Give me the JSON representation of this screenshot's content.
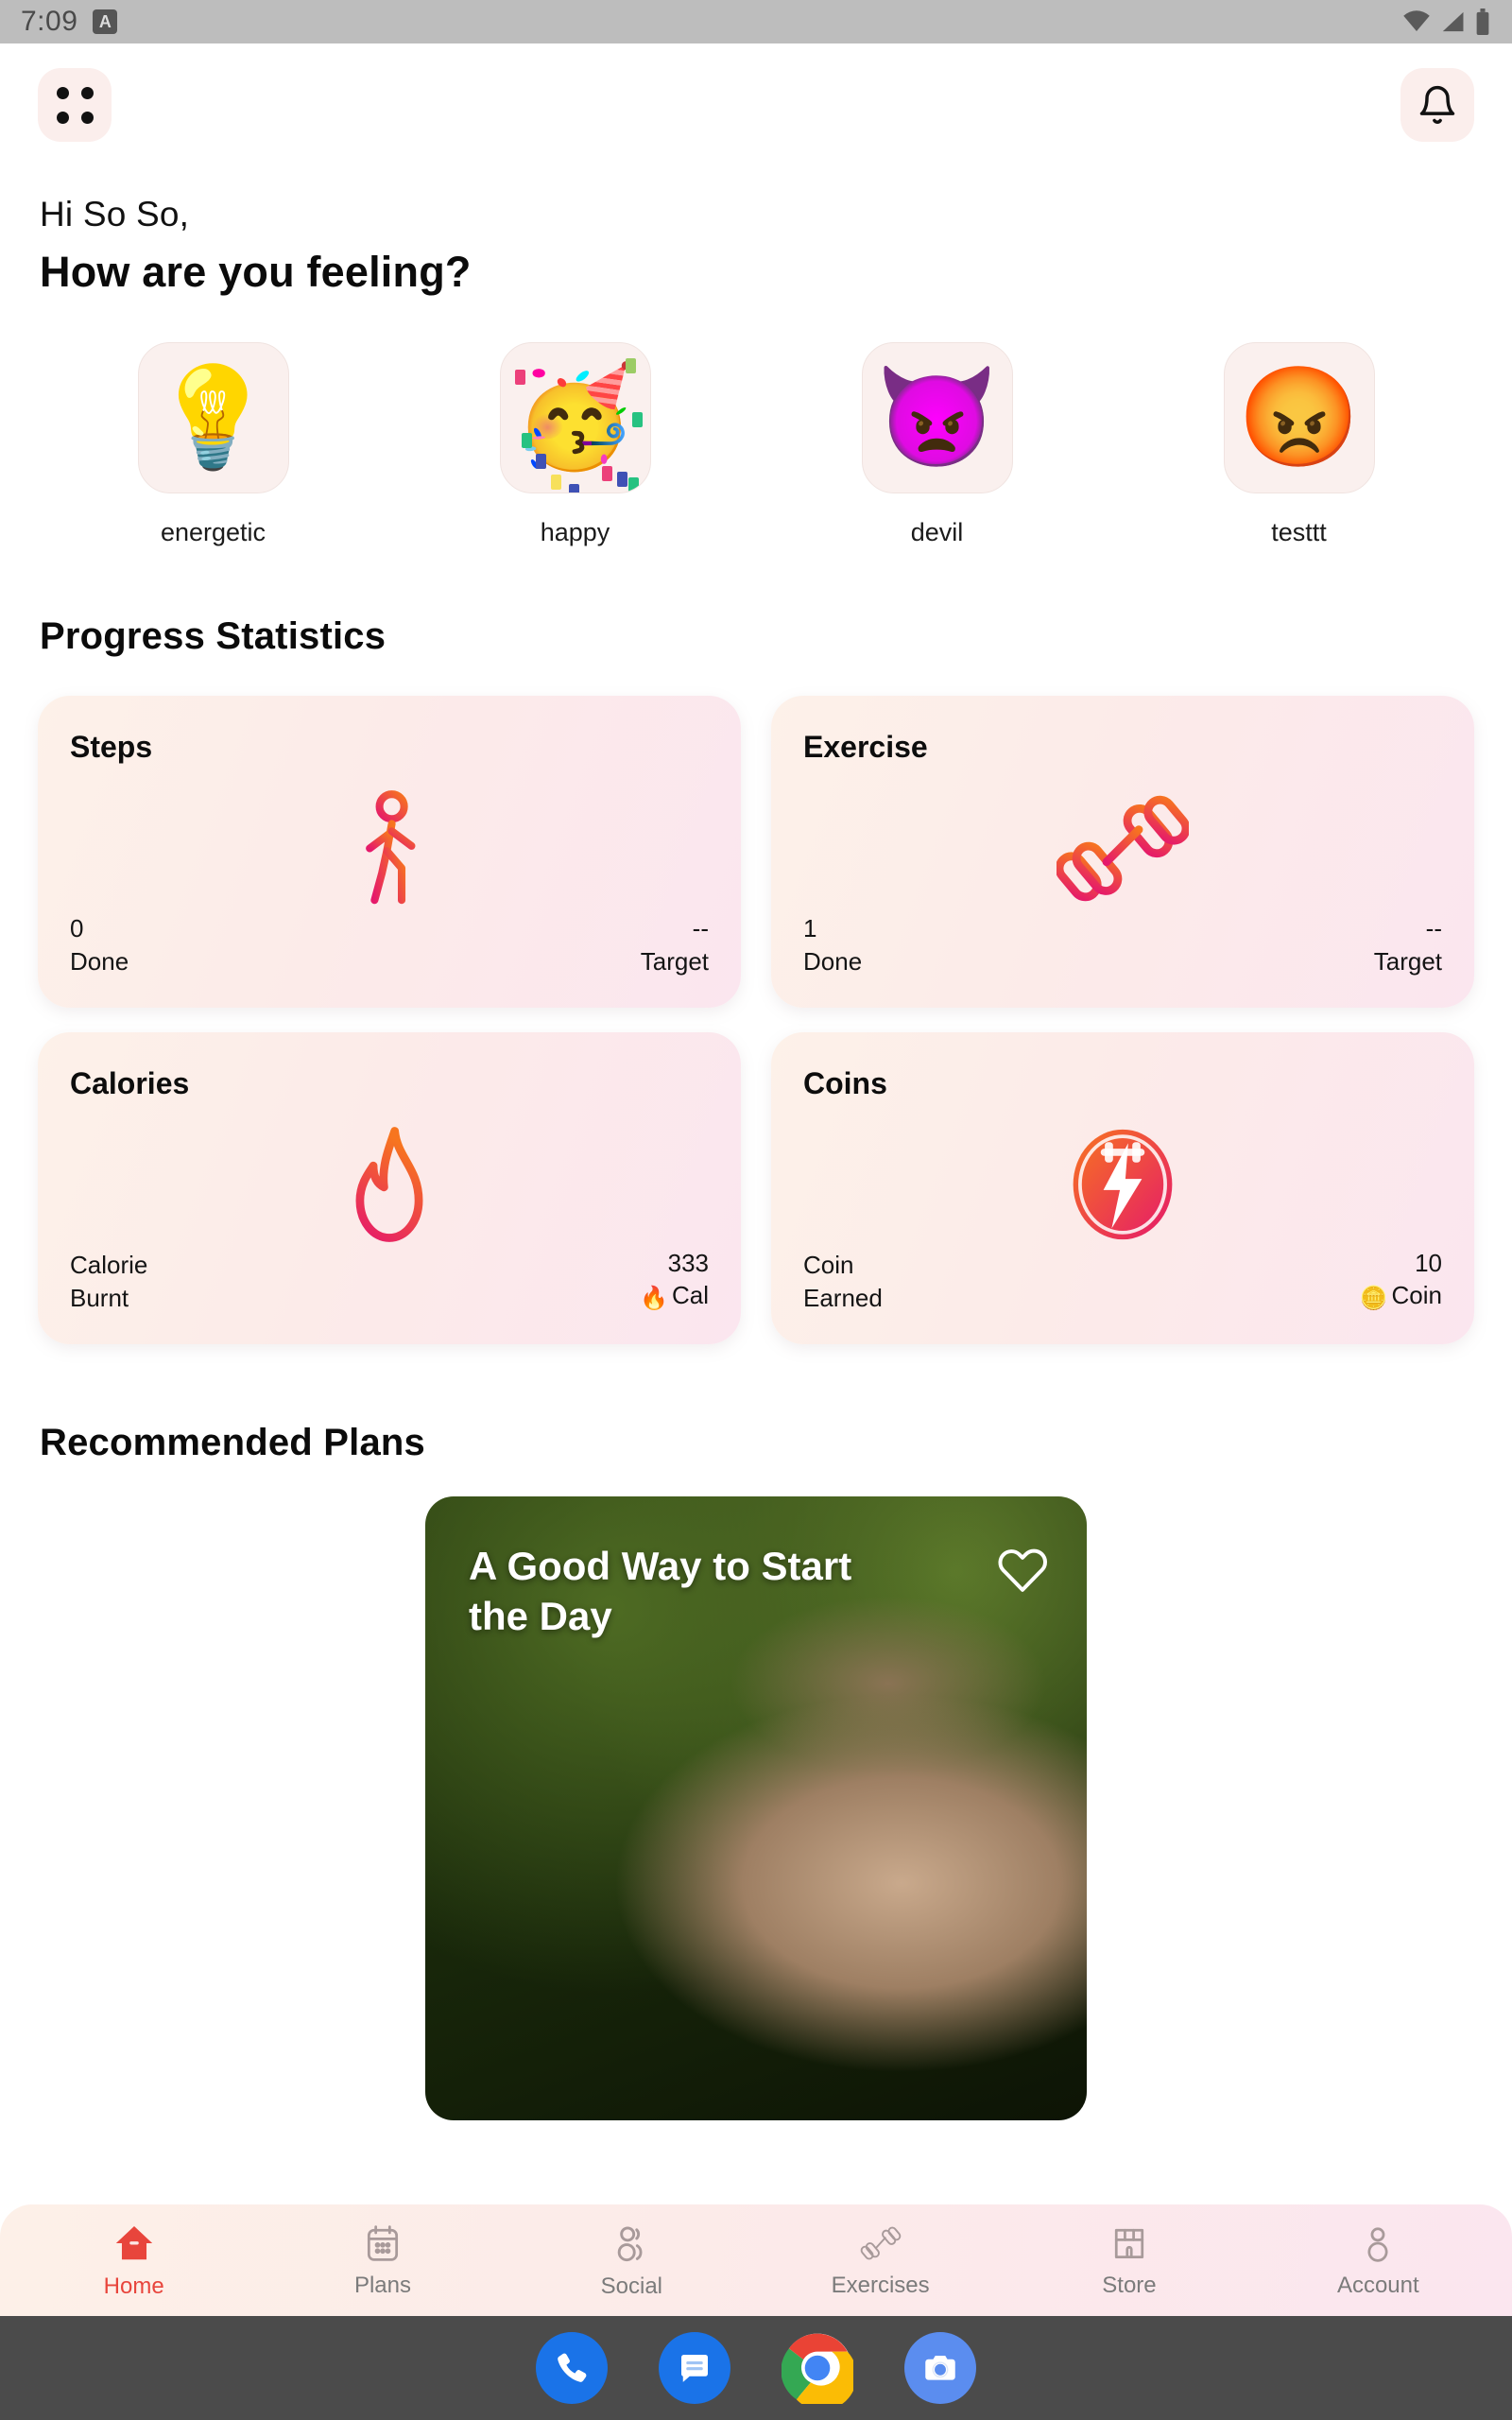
{
  "status_bar": {
    "time": "7:09",
    "alarm_badge": "A",
    "icons": [
      "wifi-icon",
      "cellular-signal-icon",
      "battery-icon"
    ]
  },
  "app_bar": {
    "menu_icon": "grid-menu-icon",
    "notification_icon": "bell-icon"
  },
  "greeting": {
    "hi": "Hi So So,",
    "question": "How are you feeling?"
  },
  "moods": {
    "items": [
      {
        "label": "energetic",
        "emoji": "💡",
        "icon": "light-bulb-emoji"
      },
      {
        "label": "happy",
        "emoji": "🥳",
        "icon": "partying-face-emoji"
      },
      {
        "label": "devil",
        "emoji": "👿",
        "icon": "devil-emoji"
      },
      {
        "label": "testtt",
        "emoji": "😡",
        "icon": "angry-face-emoji"
      }
    ]
  },
  "progress": {
    "heading": "Progress Statistics",
    "cards": [
      {
        "name": "Steps",
        "icon": "walking-person-icon",
        "left_value": "0",
        "left_label": "Done",
        "right_value": "--",
        "right_label": "Target",
        "right_prefix_icon": ""
      },
      {
        "name": "Exercise",
        "icon": "dumbbell-icon",
        "left_value": "1",
        "left_label": "Done",
        "right_value": "--",
        "right_label": "Target",
        "right_prefix_icon": ""
      },
      {
        "name": "Calories",
        "icon": "flame-icon",
        "left_value": "Calorie",
        "left_label": "Burnt",
        "right_value": "333",
        "right_label": "Cal",
        "right_prefix_icon": "🔥"
      },
      {
        "name": "Coins",
        "icon": "lightning-coin-icon",
        "left_value": "Coin",
        "left_label": "Earned",
        "right_value": "10",
        "right_label": "Coin",
        "right_prefix_icon": "🪙"
      }
    ]
  },
  "plans": {
    "heading": "Recommended Plans",
    "card": {
      "title": "A Good Way to Start the Day",
      "favorite_icon": "heart-outline-icon",
      "favorited": false
    }
  },
  "bottom_nav": {
    "active": "Home",
    "items": [
      {
        "label": "Home",
        "icon": "home-icon"
      },
      {
        "label": "Plans",
        "icon": "calendar-icon"
      },
      {
        "label": "Social",
        "icon": "people-icon"
      },
      {
        "label": "Exercises",
        "icon": "dumbbell-icon"
      },
      {
        "label": "Store",
        "icon": "shop-icon"
      },
      {
        "label": "Account",
        "icon": "person-icon"
      }
    ]
  },
  "dock": {
    "items": [
      {
        "icon": "phone-icon",
        "color": "#1a73e8"
      },
      {
        "icon": "messages-icon",
        "color": "#1a73e8"
      },
      {
        "icon": "chrome-icon",
        "color": "#ffffff"
      },
      {
        "icon": "camera-icon",
        "color": "#5b8def"
      }
    ]
  },
  "theme": {
    "accent": "#e8453c",
    "card_gradient_start": "#fdf1e9",
    "card_gradient_end": "#fbe6ef",
    "icon_gradient_start": "#f7751f",
    "icon_gradient_end": "#e5196b"
  }
}
